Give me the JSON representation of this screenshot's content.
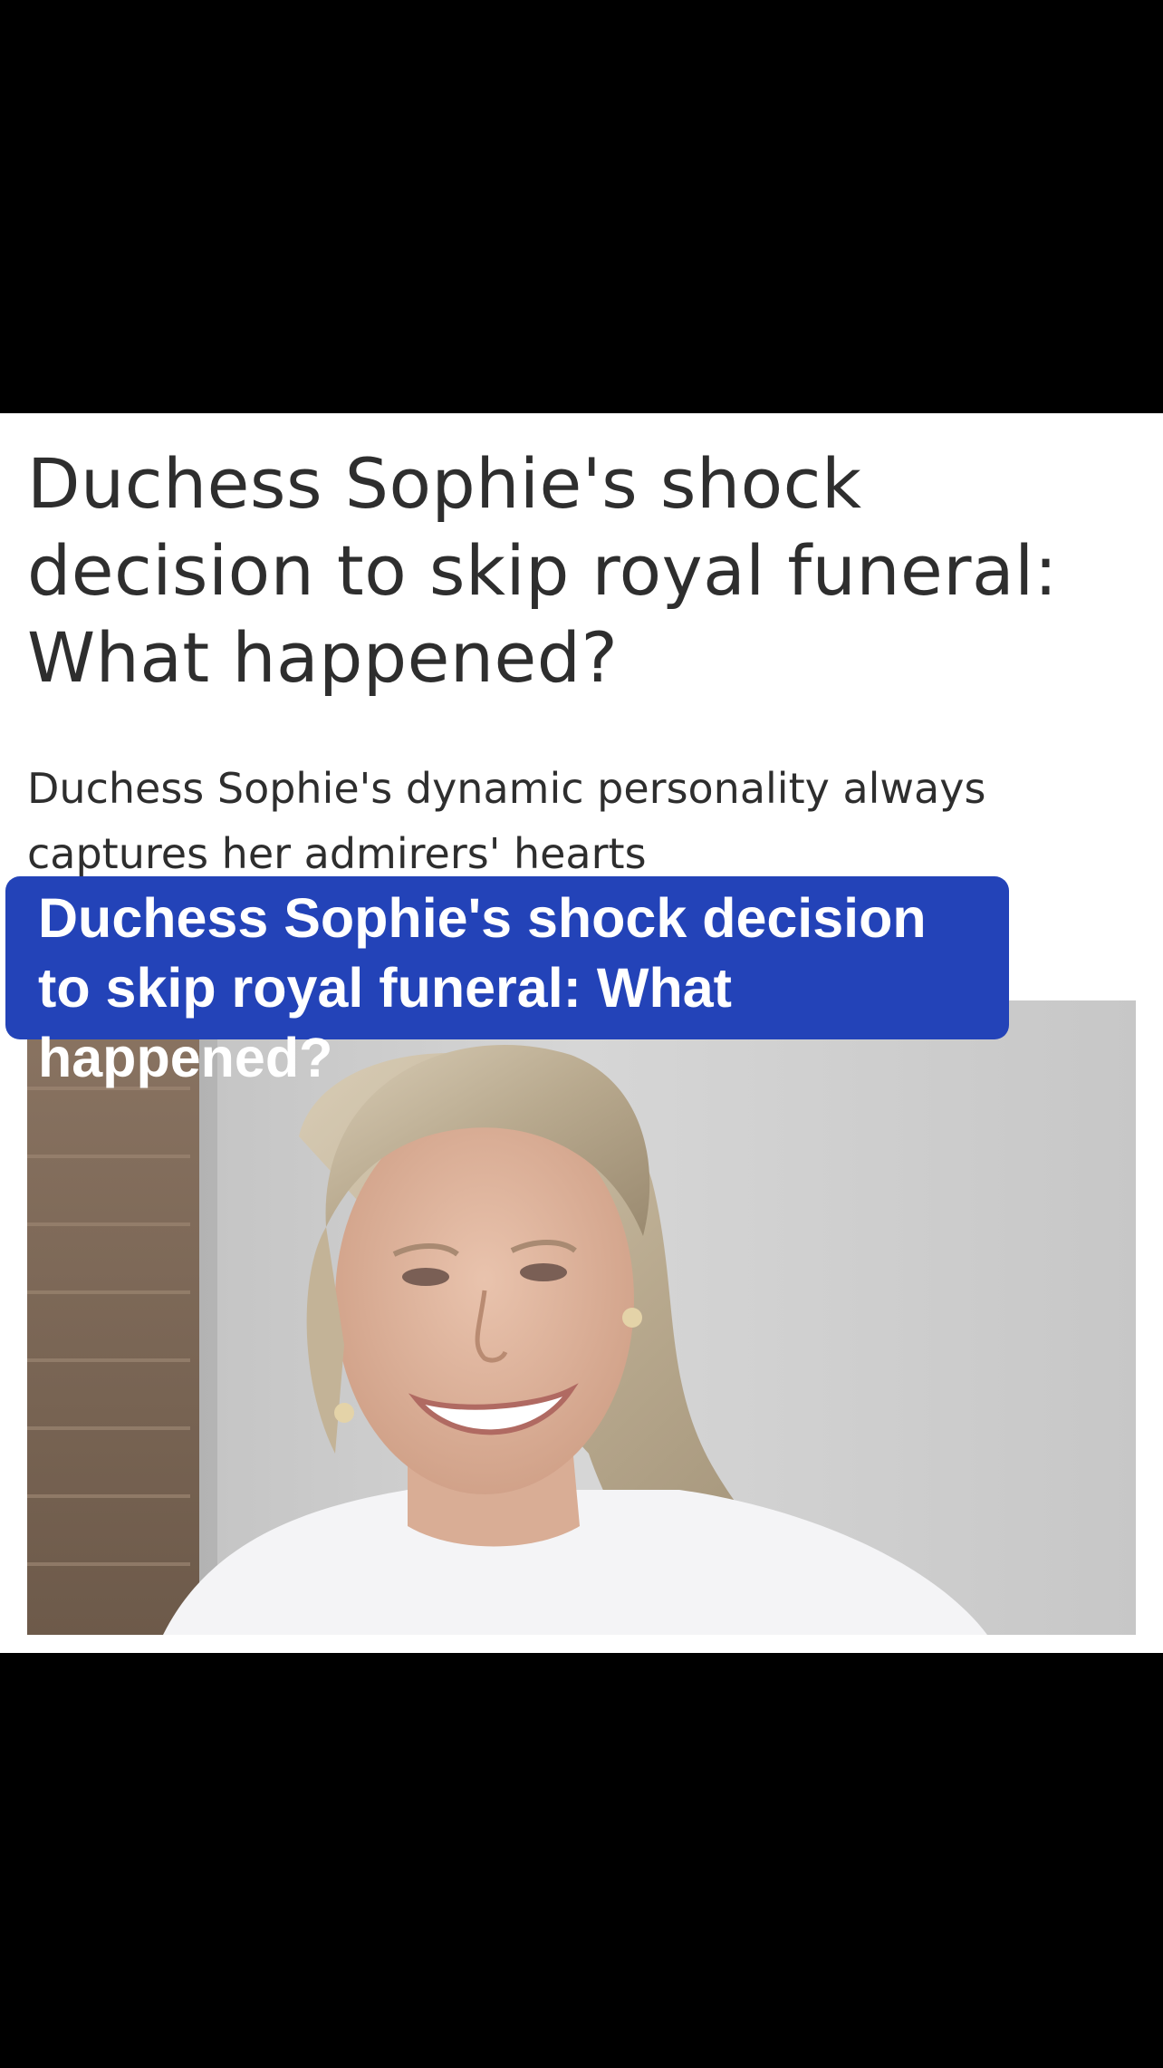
{
  "article": {
    "headline": "Duchess Sophie's shock decision to skip royal funeral: What happened?",
    "subtitle": "Duchess Sophie's dynamic personality always captures her admirers' hearts"
  },
  "overlay": {
    "text": "Duchess Sophie's shock decision to skip royal funeral: What happened?",
    "background_color": "#2343b8"
  },
  "image": {
    "subject": "smiling woman with blonde hair in a white top"
  }
}
